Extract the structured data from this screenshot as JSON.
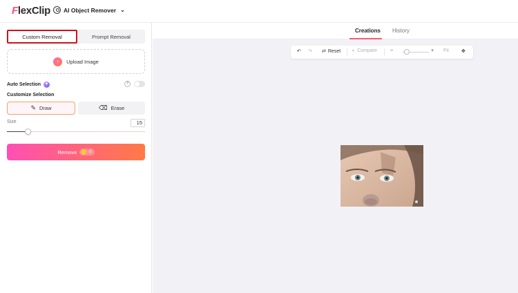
{
  "header": {
    "logo_first": "F",
    "logo_rest": "lexClip",
    "tool_label": "AI Object Remover",
    "chevron": "⌄"
  },
  "left": {
    "tabs": [
      {
        "label": "Custom Removal",
        "active": true
      },
      {
        "label": "Prompt Removal",
        "active": false
      }
    ],
    "upload_label": "Upload Image",
    "auto_selection_label": "Auto Selection",
    "auto_selection_on": false,
    "help_glyph": "?",
    "customize_label": "Customize Selection",
    "draw_label": "Draw",
    "erase_label": "Erase",
    "size_label": "Size",
    "size_value": "15",
    "size_fraction": 0.15,
    "remove_label": "Remove",
    "remove_cost": "-5"
  },
  "right": {
    "tabs": [
      {
        "label": "Creations",
        "active": true
      },
      {
        "label": "History",
        "active": false
      }
    ],
    "toolbar": {
      "reset_label": "Reset",
      "compare_label": "Compare",
      "fit_label": "Fit",
      "zoom_fraction": 0.08
    }
  },
  "colors": {
    "accent_start": "#ff4fb4",
    "accent_end": "#ff7a45",
    "highlight_border": "#d20f1c"
  }
}
